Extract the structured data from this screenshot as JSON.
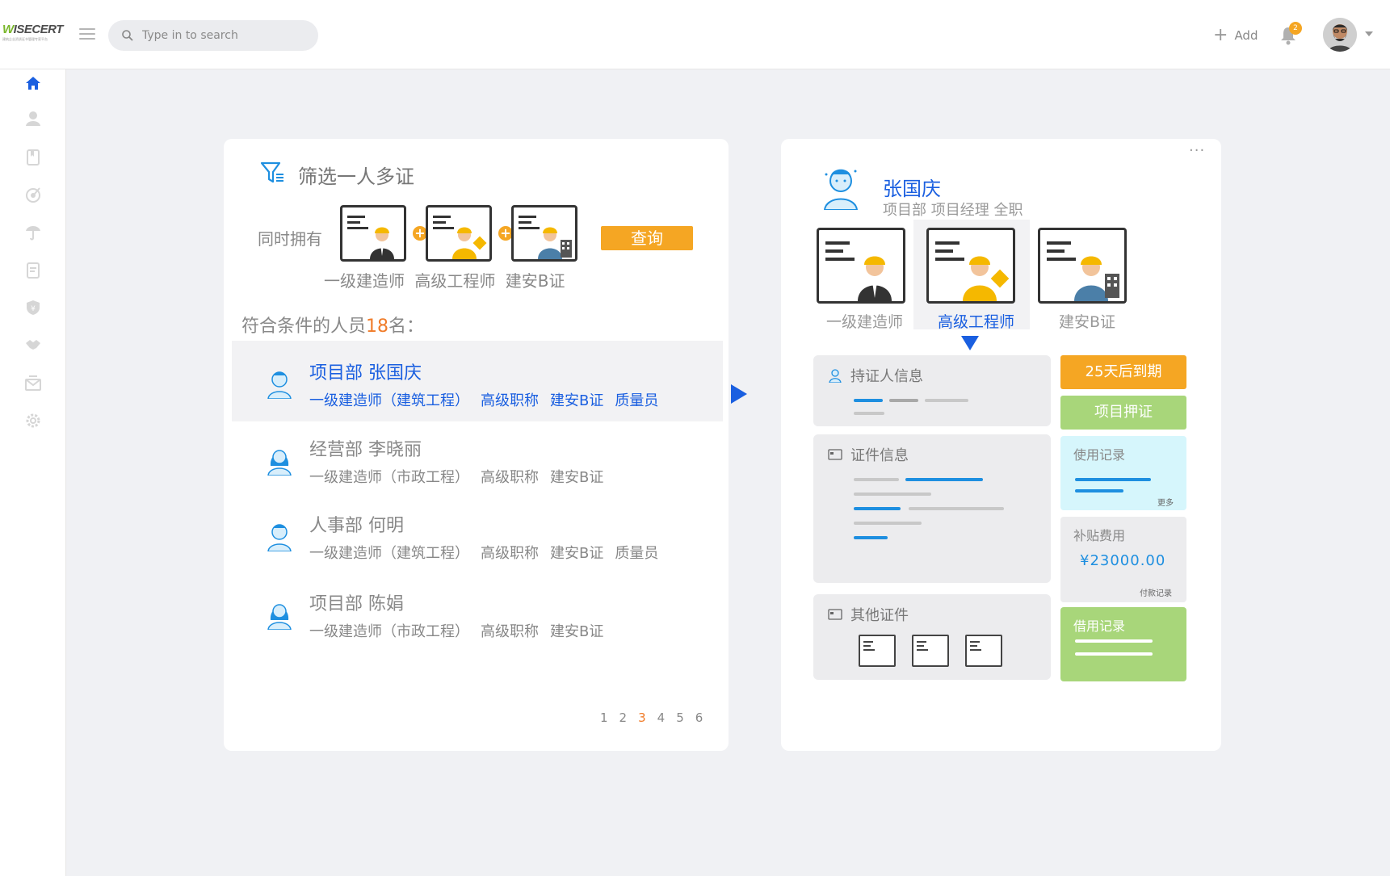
{
  "brand": {
    "logo": "WISECERT",
    "logo_sub": "建筑企业资质证书管理专家平台"
  },
  "header": {
    "search_placeholder": "Type in to search",
    "add_label": "Add",
    "notification_count": "2"
  },
  "sidebar": {
    "items": [
      "home-icon",
      "user-icon",
      "bookmark-icon",
      "target-icon",
      "umbrella-icon",
      "document-icon",
      "shield-icon",
      "handshake-icon",
      "mail-icon",
      "gear-icon"
    ],
    "active_color": "#1a5fe0"
  },
  "filter_panel": {
    "title": "筛选一人多证",
    "have_label": "同时拥有",
    "query_button": "查询",
    "cert_labels": [
      "一级建造师",
      "高级工程师",
      "建安B证"
    ],
    "match_prefix": "符合条件的人员",
    "match_count": "18",
    "match_suffix": "名：",
    "people": [
      {
        "name": "项目部 张国庆",
        "tags": [
          "一级建造师（建筑工程）",
          "高级职称",
          "建安B证",
          "质量员"
        ],
        "gender": "male",
        "active": true
      },
      {
        "name": "经营部 李晓丽",
        "tags": [
          "一级建造师（市政工程）",
          "高级职称",
          "建安B证"
        ],
        "gender": "female",
        "active": false
      },
      {
        "name": "人事部 何明",
        "tags": [
          "一级建造师（建筑工程）",
          "高级职称",
          "建安B证",
          "质量员"
        ],
        "gender": "male",
        "active": false
      },
      {
        "name": "项目部 陈娟",
        "tags": [
          "一级建造师（市政工程）",
          "高级职称",
          "建安B证"
        ],
        "gender": "female",
        "active": false
      }
    ],
    "pages": [
      "1",
      "2",
      "3",
      "4",
      "5",
      "6"
    ],
    "current_page": "3"
  },
  "detail_panel": {
    "more": "···",
    "name": "张国庆",
    "subtitle": "项目部 项目经理  全职",
    "certs": [
      "一级建造师",
      "高级工程师",
      "建安B证"
    ],
    "selected_cert": "高级工程师",
    "holder_info": "持证人信息",
    "cert_info": "证件信息",
    "other_certs": "其他证件",
    "expire": "25天后到期",
    "pledge": "项目押证",
    "usage": "使用记录",
    "usage_more": "更多",
    "subsidy": "补贴费用",
    "subsidy_amount": "¥23000.00",
    "payment_record": "付款记录",
    "borrow": "借用记录"
  },
  "colors": {
    "accent": "#1a5fe0",
    "orange": "#f5a623",
    "green": "#a8d67a",
    "cyan": "#d6f6fc",
    "count": "#f07c2a"
  }
}
